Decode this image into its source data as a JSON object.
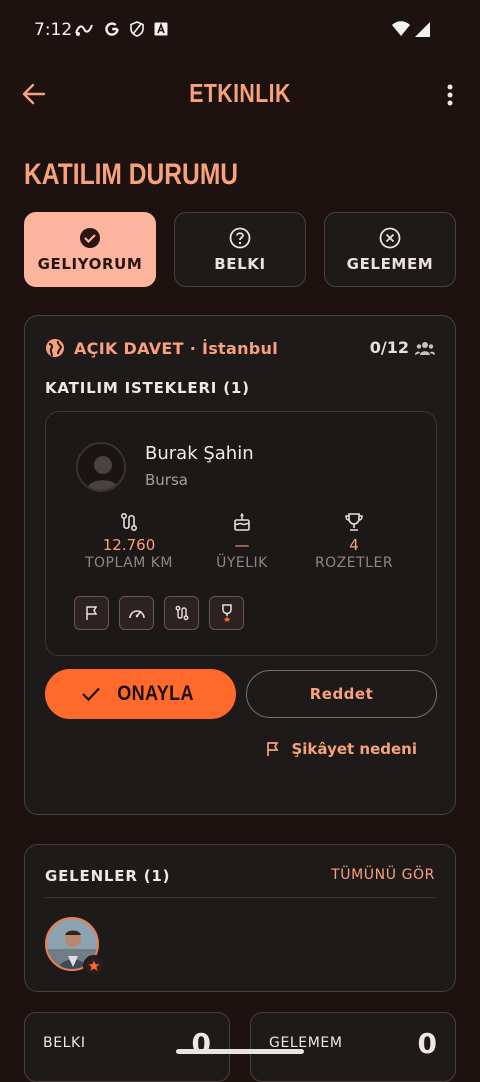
{
  "status_bar": {
    "time": "7:12",
    "icons": [
      "gesture-icon",
      "google-icon",
      "shield-icon",
      "accessibility-icon"
    ],
    "wifi": "wifi-icon",
    "signal": "signal-icon"
  },
  "app_bar": {
    "title": "ETKINLIK"
  },
  "rsvp": {
    "title": "KATILIM DURUMU",
    "options": [
      {
        "label": "GELIYORUM",
        "icon": "check-circle-icon",
        "selected": true
      },
      {
        "label": "BELKI",
        "icon": "question-circle-icon",
        "selected": false
      },
      {
        "label": "GELEMEM",
        "icon": "x-circle-icon",
        "selected": false
      }
    ]
  },
  "event": {
    "invite_label": "AÇIK DAVET · İstanbul",
    "participants": "0/12",
    "requests_title": "KATILIM ISTEKLERI (1)",
    "request": {
      "name": "Burak Şahin",
      "city": "Bursa",
      "stats": [
        {
          "value": "12.760",
          "caption": "TOPLAM KM",
          "icon": "route-icon"
        },
        {
          "value": "—",
          "caption": "ÜYELIK",
          "icon": "cake-icon"
        },
        {
          "value": "4",
          "caption": "ROZETLER",
          "icon": "trophy-icon"
        }
      ],
      "badges": [
        "flag-badge-icon",
        "speedometer-badge-icon",
        "route-badge-icon",
        "medal-badge-icon"
      ],
      "approve_label": "ONAYLA",
      "reject_label": "Reddet",
      "report_label": "Şikâyet nedeni"
    }
  },
  "attendees": {
    "title": "GELENLER (1)",
    "see_all": "TÜMÜNÜ GÖR"
  },
  "summary": [
    {
      "label": "BELKI",
      "count": "0"
    },
    {
      "label": "GELEMEM",
      "count": "0"
    }
  ],
  "colors": {
    "accent": "#f7a17d",
    "primary_button": "#fd6a2c",
    "selected_chip": "#fbb49d",
    "background": "#1d1210"
  }
}
